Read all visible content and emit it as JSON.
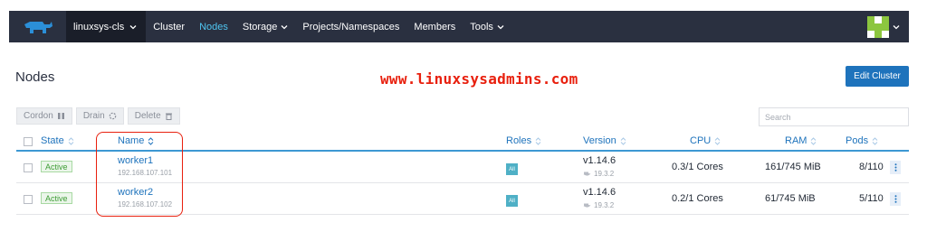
{
  "nav": {
    "cluster": "linuxsys-cls",
    "items": [
      {
        "label": "Cluster"
      },
      {
        "label": "Nodes"
      },
      {
        "label": "Storage"
      },
      {
        "label": "Projects/Namespaces"
      },
      {
        "label": "Members"
      },
      {
        "label": "Tools"
      }
    ],
    "active_item": "Nodes"
  },
  "page": {
    "title": "Nodes",
    "watermark": "www.linuxsysadmins.com",
    "edit_cluster": "Edit Cluster"
  },
  "actions": {
    "cordon": "Cordon",
    "drain": "Drain",
    "delete": "Delete"
  },
  "search": {
    "placeholder": "Search"
  },
  "table": {
    "headers": {
      "state": "State",
      "name": "Name",
      "roles": "Roles",
      "version": "Version",
      "cpu": "CPU",
      "ram": "RAM",
      "pods": "Pods"
    },
    "rows": [
      {
        "state": "Active",
        "name": "worker1",
        "ip": "192.168.107.101",
        "role": "All",
        "version": "v1.14.6",
        "docker": "19.3.2",
        "cpu": "0.3/1 Cores",
        "ram": "161/745 MiB",
        "pods": "8/110"
      },
      {
        "state": "Active",
        "name": "worker2",
        "ip": "192.168.107.102",
        "role": "All",
        "version": "v1.14.6",
        "docker": "19.3.2",
        "cpu": "0.2/1 Cores",
        "ram": "61/745 MiB",
        "pods": "5/110"
      }
    ]
  },
  "colors": {
    "nav_bg": "#2a3040",
    "accent": "#1e73bc",
    "active_nav": "#4fc5f0",
    "watermark": "#e8200e",
    "active_badge": "#3e9c35"
  }
}
